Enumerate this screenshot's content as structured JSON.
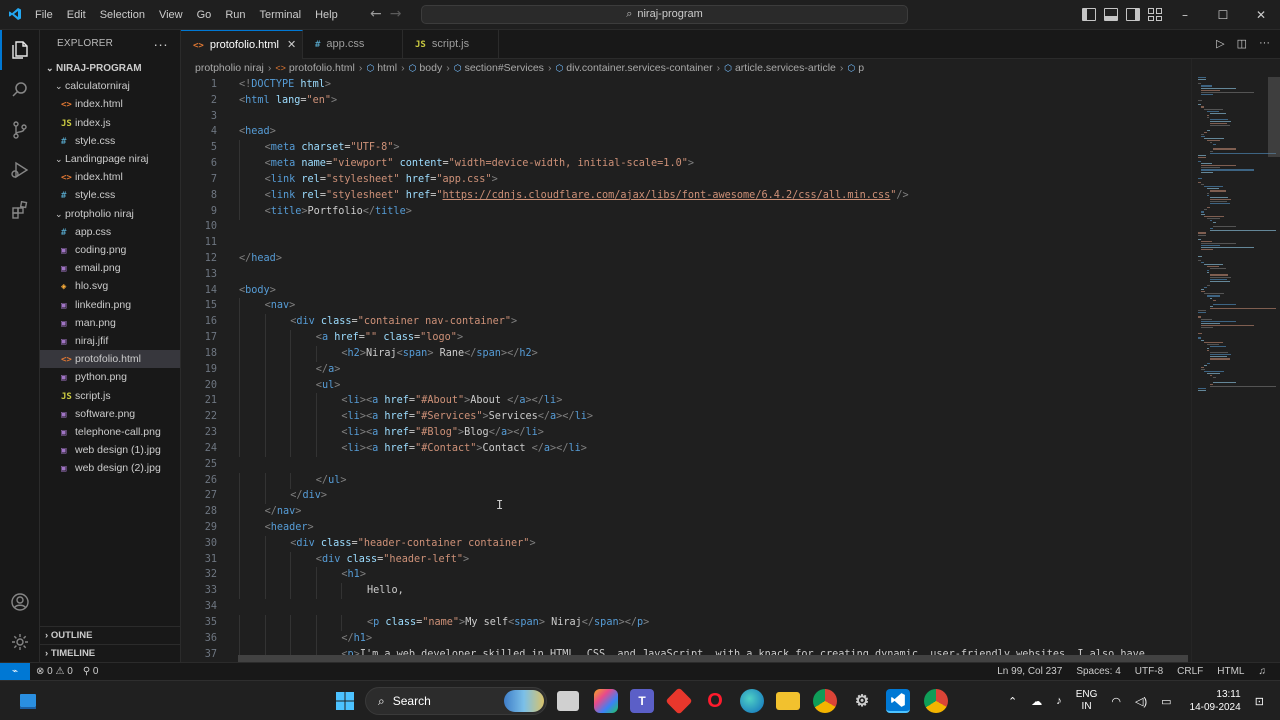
{
  "titlebar": {
    "menu": [
      "File",
      "Edit",
      "Selection",
      "View",
      "Go",
      "Run",
      "Terminal",
      "Help"
    ],
    "command_center": "niraj-program",
    "window_controls": [
      "–",
      "☐",
      "✕"
    ]
  },
  "explorer": {
    "header": "EXPLORER",
    "more": "···",
    "root": "NIRAJ-PROGRAM",
    "folders": [
      {
        "name": "calculatorniraj",
        "files": [
          {
            "name": "index.html",
            "type": "html"
          },
          {
            "name": "index.js",
            "type": "js"
          },
          {
            "name": "style.css",
            "type": "css"
          }
        ]
      },
      {
        "name": "Landingpage niraj",
        "files": [
          {
            "name": "index.html",
            "type": "html"
          },
          {
            "name": "style.css",
            "type": "css"
          }
        ]
      },
      {
        "name": "protpholio niraj",
        "files": [
          {
            "name": "app.css",
            "type": "css"
          },
          {
            "name": "coding.png",
            "type": "img"
          },
          {
            "name": "email.png",
            "type": "img"
          },
          {
            "name": "hlo.svg",
            "type": "svg"
          },
          {
            "name": "linkedin.png",
            "type": "img"
          },
          {
            "name": "man.png",
            "type": "img"
          },
          {
            "name": "niraj.jfif",
            "type": "img"
          },
          {
            "name": "protofolio.html",
            "type": "html",
            "selected": true
          },
          {
            "name": "python.png",
            "type": "img"
          },
          {
            "name": "script.js",
            "type": "js"
          },
          {
            "name": "software.png",
            "type": "img"
          },
          {
            "name": "telephone-call.png",
            "type": "img"
          },
          {
            "name": "web design (1).jpg",
            "type": "img"
          },
          {
            "name": "web design (2).jpg",
            "type": "img"
          }
        ]
      }
    ],
    "outline": "OUTLINE",
    "timeline": "TIMELINE"
  },
  "tabs": [
    {
      "label": "protofolio.html",
      "type": "html",
      "active": true
    },
    {
      "label": "app.css",
      "type": "css",
      "active": false
    },
    {
      "label": "script.js",
      "type": "js",
      "active": false
    }
  ],
  "breadcrumb": [
    "protpholio niraj",
    "protofolio.html",
    "html",
    "body",
    "section#Services",
    "div.container.services-container",
    "article.services-article",
    "p"
  ],
  "code_lines": [
    {
      "n": 1,
      "i": 0,
      "t": [
        [
          "br",
          "<!"
        ],
        [
          "tag",
          "DOCTYPE "
        ],
        [
          "attr",
          "html"
        ],
        [
          "br",
          ">"
        ]
      ]
    },
    {
      "n": 2,
      "i": 0,
      "t": [
        [
          "br",
          "<"
        ],
        [
          "tag",
          "html "
        ],
        [
          "attr",
          "lang"
        ],
        [
          "txt",
          "="
        ],
        [
          "str",
          "\"en\""
        ],
        [
          "br",
          ">"
        ]
      ]
    },
    {
      "n": 3,
      "i": 0,
      "t": []
    },
    {
      "n": 4,
      "i": 0,
      "t": [
        [
          "br",
          "<"
        ],
        [
          "tag",
          "head"
        ],
        [
          "br",
          ">"
        ]
      ]
    },
    {
      "n": 5,
      "i": 1,
      "t": [
        [
          "br",
          "<"
        ],
        [
          "tag",
          "meta "
        ],
        [
          "attr",
          "charset"
        ],
        [
          "txt",
          "="
        ],
        [
          "str",
          "\"UTF-8\""
        ],
        [
          "br",
          ">"
        ]
      ]
    },
    {
      "n": 6,
      "i": 1,
      "t": [
        [
          "br",
          "<"
        ],
        [
          "tag",
          "meta "
        ],
        [
          "attr",
          "name"
        ],
        [
          "txt",
          "="
        ],
        [
          "str",
          "\"viewport\" "
        ],
        [
          "attr",
          "content"
        ],
        [
          "txt",
          "="
        ],
        [
          "str",
          "\"width=device-width, initial-scale=1.0\""
        ],
        [
          "br",
          ">"
        ]
      ]
    },
    {
      "n": 7,
      "i": 1,
      "t": [
        [
          "br",
          "<"
        ],
        [
          "tag",
          "link "
        ],
        [
          "attr",
          "rel"
        ],
        [
          "txt",
          "="
        ],
        [
          "str",
          "\"stylesheet\" "
        ],
        [
          "attr",
          "href"
        ],
        [
          "txt",
          "="
        ],
        [
          "str",
          "\"app.css\""
        ],
        [
          "br",
          ">"
        ]
      ]
    },
    {
      "n": 8,
      "i": 1,
      "t": [
        [
          "br",
          "<"
        ],
        [
          "tag",
          "link "
        ],
        [
          "attr",
          "rel"
        ],
        [
          "txt",
          "="
        ],
        [
          "str",
          "\"stylesheet\" "
        ],
        [
          "attr",
          "href"
        ],
        [
          "txt",
          "="
        ],
        [
          "str",
          "\""
        ],
        [
          "link",
          "https://cdnjs.cloudflare.com/ajax/libs/font-awesome/6.4.2/css/all.min.css"
        ],
        [
          "str",
          "\""
        ],
        [
          "br",
          "/>"
        ]
      ]
    },
    {
      "n": 9,
      "i": 1,
      "t": [
        [
          "br",
          "<"
        ],
        [
          "tag",
          "title"
        ],
        [
          "br",
          ">"
        ],
        [
          "txt",
          "Portfolio"
        ],
        [
          "br",
          "</"
        ],
        [
          "tag",
          "title"
        ],
        [
          "br",
          ">"
        ]
      ]
    },
    {
      "n": 10,
      "i": 0,
      "t": []
    },
    {
      "n": 11,
      "i": 0,
      "t": []
    },
    {
      "n": 12,
      "i": 0,
      "t": [
        [
          "br",
          "</"
        ],
        [
          "tag",
          "head"
        ],
        [
          "br",
          ">"
        ]
      ]
    },
    {
      "n": 13,
      "i": 0,
      "t": []
    },
    {
      "n": 14,
      "i": 0,
      "t": [
        [
          "br",
          "<"
        ],
        [
          "tag",
          "body"
        ],
        [
          "br",
          ">"
        ]
      ]
    },
    {
      "n": 15,
      "i": 1,
      "t": [
        [
          "br",
          "<"
        ],
        [
          "tag",
          "nav"
        ],
        [
          "br",
          ">"
        ]
      ]
    },
    {
      "n": 16,
      "i": 2,
      "t": [
        [
          "br",
          "<"
        ],
        [
          "tag",
          "div "
        ],
        [
          "attr",
          "class"
        ],
        [
          "txt",
          "="
        ],
        [
          "str",
          "\"container nav-container\""
        ],
        [
          "br",
          ">"
        ]
      ]
    },
    {
      "n": 17,
      "i": 3,
      "t": [
        [
          "br",
          "<"
        ],
        [
          "tag",
          "a "
        ],
        [
          "attr",
          "href"
        ],
        [
          "txt",
          "="
        ],
        [
          "str",
          "\"\" "
        ],
        [
          "attr",
          "class"
        ],
        [
          "txt",
          "="
        ],
        [
          "str",
          "\"logo\""
        ],
        [
          "br",
          ">"
        ]
      ]
    },
    {
      "n": 18,
      "i": 4,
      "t": [
        [
          "br",
          "<"
        ],
        [
          "tag",
          "h2"
        ],
        [
          "br",
          ">"
        ],
        [
          "txt",
          "Niraj"
        ],
        [
          "br",
          "<"
        ],
        [
          "tag",
          "span"
        ],
        [
          "br",
          ">"
        ],
        [
          "txt",
          " Rane"
        ],
        [
          "br",
          "</"
        ],
        [
          "tag",
          "span"
        ],
        [
          "br",
          "></"
        ],
        [
          "tag",
          "h2"
        ],
        [
          "br",
          ">"
        ]
      ]
    },
    {
      "n": 19,
      "i": 3,
      "t": [
        [
          "br",
          "</"
        ],
        [
          "tag",
          "a"
        ],
        [
          "br",
          ">"
        ]
      ]
    },
    {
      "n": 20,
      "i": 3,
      "t": [
        [
          "br",
          "<"
        ],
        [
          "tag",
          "ul"
        ],
        [
          "br",
          ">"
        ]
      ]
    },
    {
      "n": 21,
      "i": 4,
      "t": [
        [
          "br",
          "<"
        ],
        [
          "tag",
          "li"
        ],
        [
          "br",
          "><"
        ],
        [
          "tag",
          "a "
        ],
        [
          "attr",
          "href"
        ],
        [
          "txt",
          "="
        ],
        [
          "str",
          "\"#About\""
        ],
        [
          "br",
          ">"
        ],
        [
          "txt",
          "About "
        ],
        [
          "br",
          "</"
        ],
        [
          "tag",
          "a"
        ],
        [
          "br",
          "></"
        ],
        [
          "tag",
          "li"
        ],
        [
          "br",
          ">"
        ]
      ]
    },
    {
      "n": 22,
      "i": 4,
      "t": [
        [
          "br",
          "<"
        ],
        [
          "tag",
          "li"
        ],
        [
          "br",
          "><"
        ],
        [
          "tag",
          "a "
        ],
        [
          "attr",
          "href"
        ],
        [
          "txt",
          "="
        ],
        [
          "str",
          "\"#Services\""
        ],
        [
          "br",
          ">"
        ],
        [
          "txt",
          "Services"
        ],
        [
          "br",
          "</"
        ],
        [
          "tag",
          "a"
        ],
        [
          "br",
          "></"
        ],
        [
          "tag",
          "li"
        ],
        [
          "br",
          ">"
        ]
      ]
    },
    {
      "n": 23,
      "i": 4,
      "t": [
        [
          "br",
          "<"
        ],
        [
          "tag",
          "li"
        ],
        [
          "br",
          "><"
        ],
        [
          "tag",
          "a "
        ],
        [
          "attr",
          "href"
        ],
        [
          "txt",
          "="
        ],
        [
          "str",
          "\"#Blog\""
        ],
        [
          "br",
          ">"
        ],
        [
          "txt",
          "Blog"
        ],
        [
          "br",
          "</"
        ],
        [
          "tag",
          "a"
        ],
        [
          "br",
          "></"
        ],
        [
          "tag",
          "li"
        ],
        [
          "br",
          ">"
        ]
      ]
    },
    {
      "n": 24,
      "i": 4,
      "t": [
        [
          "br",
          "<"
        ],
        [
          "tag",
          "li"
        ],
        [
          "br",
          "><"
        ],
        [
          "tag",
          "a "
        ],
        [
          "attr",
          "href"
        ],
        [
          "txt",
          "="
        ],
        [
          "str",
          "\"#Contact\""
        ],
        [
          "br",
          ">"
        ],
        [
          "txt",
          "Contact "
        ],
        [
          "br",
          "</"
        ],
        [
          "tag",
          "a"
        ],
        [
          "br",
          "></"
        ],
        [
          "tag",
          "li"
        ],
        [
          "br",
          ">"
        ]
      ]
    },
    {
      "n": 25,
      "i": 0,
      "t": []
    },
    {
      "n": 26,
      "i": 3,
      "t": [
        [
          "br",
          "</"
        ],
        [
          "tag",
          "ul"
        ],
        [
          "br",
          ">"
        ]
      ]
    },
    {
      "n": 27,
      "i": 2,
      "t": [
        [
          "br",
          "</"
        ],
        [
          "tag",
          "div"
        ],
        [
          "br",
          ">"
        ]
      ]
    },
    {
      "n": 28,
      "i": 1,
      "t": [
        [
          "br",
          "</"
        ],
        [
          "tag",
          "nav"
        ],
        [
          "br",
          ">"
        ]
      ]
    },
    {
      "n": 29,
      "i": 1,
      "t": [
        [
          "br",
          "<"
        ],
        [
          "tag",
          "header"
        ],
        [
          "br",
          ">"
        ]
      ]
    },
    {
      "n": 30,
      "i": 2,
      "t": [
        [
          "br",
          "<"
        ],
        [
          "tag",
          "div "
        ],
        [
          "attr",
          "class"
        ],
        [
          "txt",
          "="
        ],
        [
          "str",
          "\"header-container container\""
        ],
        [
          "br",
          ">"
        ]
      ]
    },
    {
      "n": 31,
      "i": 3,
      "t": [
        [
          "br",
          "<"
        ],
        [
          "tag",
          "div "
        ],
        [
          "attr",
          "class"
        ],
        [
          "txt",
          "="
        ],
        [
          "str",
          "\"header-left\""
        ],
        [
          "br",
          ">"
        ]
      ]
    },
    {
      "n": 32,
      "i": 4,
      "t": [
        [
          "br",
          "<"
        ],
        [
          "tag",
          "h1"
        ],
        [
          "br",
          ">"
        ]
      ]
    },
    {
      "n": 33,
      "i": 5,
      "t": [
        [
          "txt",
          "Hello,"
        ]
      ]
    },
    {
      "n": 34,
      "i": 0,
      "t": []
    },
    {
      "n": 35,
      "i": 5,
      "t": [
        [
          "br",
          "<"
        ],
        [
          "tag",
          "p "
        ],
        [
          "attr",
          "class"
        ],
        [
          "txt",
          "="
        ],
        [
          "str",
          "\"name\""
        ],
        [
          "br",
          ">"
        ],
        [
          "txt",
          "My self"
        ],
        [
          "br",
          "<"
        ],
        [
          "tag",
          "span"
        ],
        [
          "br",
          ">"
        ],
        [
          "txt",
          " Niraj"
        ],
        [
          "br",
          "</"
        ],
        [
          "tag",
          "span"
        ],
        [
          "br",
          "></"
        ],
        [
          "tag",
          "p"
        ],
        [
          "br",
          ">"
        ]
      ]
    },
    {
      "n": 36,
      "i": 4,
      "t": [
        [
          "br",
          "</"
        ],
        [
          "tag",
          "h1"
        ],
        [
          "br",
          ">"
        ]
      ]
    },
    {
      "n": 37,
      "i": 4,
      "t": [
        [
          "br",
          "<"
        ],
        [
          "tag",
          "p"
        ],
        [
          "br",
          ">"
        ],
        [
          "txt",
          "I'm a web developer skilled in HTML, CSS, and JavaScript, with a knack for creating dynamic, user-friendly websites. I also have"
        ]
      ]
    }
  ],
  "statusbar": {
    "remote": "⌁",
    "errors": "⊗ 0 ⚠ 0",
    "ports": "⚲ 0",
    "position": "Ln 99, Col 237",
    "spaces": "Spaces: 4",
    "encoding": "UTF-8",
    "eol": "CRLF",
    "language": "HTML",
    "bell": "🔔"
  },
  "taskbar": {
    "search_label": "Search",
    "lang_top": "ENG",
    "lang_bottom": "IN",
    "time": "13:11",
    "date": "14-09-2024"
  },
  "colors": {
    "accent": "#0078d4",
    "tag": "#569cd6",
    "attr": "#9cdcfe",
    "string": "#ce9178"
  }
}
